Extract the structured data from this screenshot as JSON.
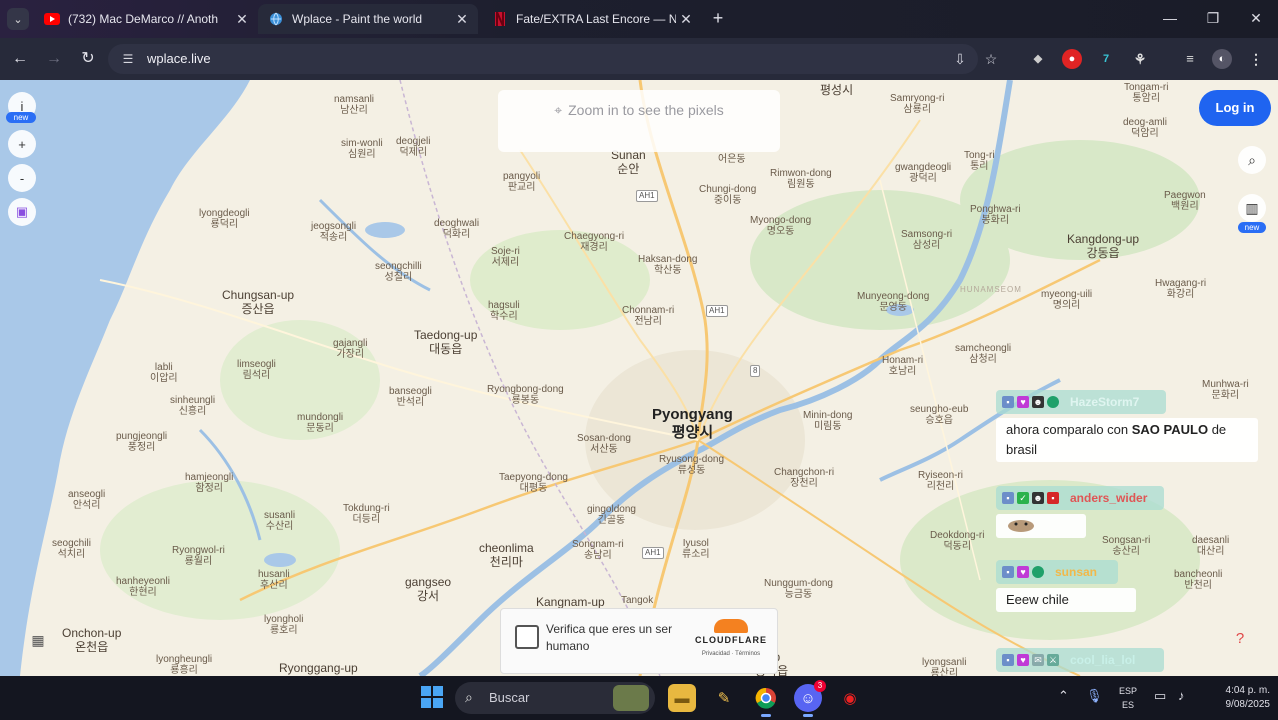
{
  "browser": {
    "tabs": [
      {
        "title": "(732) Mac DeMarco // Another",
        "favicon": "youtube-icon",
        "active": false
      },
      {
        "title": "Wplace - Paint the world",
        "favicon": "globe-icon",
        "active": true
      },
      {
        "title": "Fate/EXTRA Last Encore — Netf",
        "favicon": "netflix-icon",
        "active": false
      }
    ],
    "url": "wplace.live",
    "new_tab_glyph": "+"
  },
  "map": {
    "zoom_hint": "Zoom in to see the pixels",
    "login_label": "Log in",
    "badge_new": "new",
    "left_tool_info": "i",
    "left_tool_zoom_in": "+",
    "left_tool_zoom_out": "-",
    "places": [
      {
        "en": "namsanli",
        "ko": "남산리"
      },
      {
        "en": "sim-wonli",
        "ko": "심원리"
      },
      {
        "en": "deogjeli",
        "ko": "덕제리"
      },
      {
        "en": "pangyoli",
        "ko": "판교리"
      },
      {
        "en": "Sunan",
        "ko": "순안"
      },
      {
        "en": "",
        "ko": "어은동"
      },
      {
        "en": "",
        "ko": "평성시"
      },
      {
        "en": "Samryong-ri",
        "ko": "삼룡리"
      },
      {
        "en": "Tongam-ri",
        "ko": "통암리"
      },
      {
        "en": "deog-amli",
        "ko": "덕암리"
      },
      {
        "en": "lyongdeogli",
        "ko": "룡덕리"
      },
      {
        "en": "jeogsongli",
        "ko": "적송리"
      },
      {
        "en": "deoghwali",
        "ko": "덕화리"
      },
      {
        "en": "Soje-ri",
        "ko": "서제리"
      },
      {
        "en": "Chaegyong-ri",
        "ko": "재경리"
      },
      {
        "en": "Chungi-dong",
        "ko": "중이동"
      },
      {
        "en": "Rimwon-dong",
        "ko": "림원동"
      },
      {
        "en": "gwangdeogli",
        "ko": "광덕리"
      },
      {
        "en": "Tong-ri",
        "ko": "통리"
      },
      {
        "en": "Myongo-dong",
        "ko": "명오동"
      },
      {
        "en": "Haksan-dong",
        "ko": "학산동"
      },
      {
        "en": "Samsong-ri",
        "ko": "삼성리"
      },
      {
        "en": "Ponghwa-ri",
        "ko": "봉화리"
      },
      {
        "en": "Paegwon",
        "ko": "백원리"
      },
      {
        "en": "Kangdong-up",
        "ko": "강동읍"
      },
      {
        "en": "seongchilli",
        "ko": "성칠리"
      },
      {
        "en": "Chungsan-up",
        "ko": "증산읍"
      },
      {
        "en": "hagsuli",
        "ko": "학수리"
      },
      {
        "en": "Chonnam-ri",
        "ko": "전남리"
      },
      {
        "en": "Munyeong-dong",
        "ko": "문영동"
      },
      {
        "en": "myeong-uili",
        "ko": "명의리"
      },
      {
        "en": "Hwagang-ri",
        "ko": "화강리"
      },
      {
        "en": "Taedong-up",
        "ko": "대동읍"
      },
      {
        "en": "gajangli",
        "ko": "가장리"
      },
      {
        "en": "samcheongli",
        "ko": "삼청리"
      },
      {
        "en": "Honam-ri",
        "ko": "호남리"
      },
      {
        "en": "labli",
        "ko": "이압리"
      },
      {
        "en": "limseogli",
        "ko": "림석리"
      },
      {
        "en": "banseogli",
        "ko": "반석리"
      },
      {
        "en": "Ryongbong-dong",
        "ko": "룡봉동"
      },
      {
        "en": "sinheungli",
        "ko": "신흥리"
      },
      {
        "en": "mundongli",
        "ko": "문동리"
      },
      {
        "en": "Pyongyang",
        "ko": "평양시"
      },
      {
        "en": "Minin-dong",
        "ko": "미림동"
      },
      {
        "en": "seungho-eub",
        "ko": "승호읍"
      },
      {
        "en": "Munhwa-ri",
        "ko": "문화리"
      },
      {
        "en": "pungjeongli",
        "ko": "풍정리"
      },
      {
        "en": "Sosan-dong",
        "ko": "서산동"
      },
      {
        "en": "Ryusong-dong",
        "ko": "류성동"
      },
      {
        "en": "Changchon-ri",
        "ko": "장천리"
      },
      {
        "en": "Ryiseon-ri",
        "ko": "리천리"
      },
      {
        "en": "anseogli",
        "ko": "안석리"
      },
      {
        "en": "hamjeongli",
        "ko": "함정리"
      },
      {
        "en": "Taepyong-dong",
        "ko": "대평동"
      },
      {
        "en": "seogchili",
        "ko": "석치리"
      },
      {
        "en": "susanli",
        "ko": "수산리"
      },
      {
        "en": "Tokdung-ri",
        "ko": "더등리"
      },
      {
        "en": "gingoldong",
        "ko": "긴골동"
      },
      {
        "en": "Songnam-ri",
        "ko": "송남리"
      },
      {
        "en": "Iyusol",
        "ko": "류소리"
      },
      {
        "en": "Deokdong-ri",
        "ko": "덕동리"
      },
      {
        "en": "Songsan-ri",
        "ko": "송산리"
      },
      {
        "en": "daesanli",
        "ko": "대산리"
      },
      {
        "en": "Ryongwol-ri",
        "ko": "룡월리"
      },
      {
        "en": "cheonlima",
        "ko": "천리마"
      },
      {
        "en": "hanheyeonli",
        "ko": "한현리"
      },
      {
        "en": "husanli",
        "ko": "후산리"
      },
      {
        "en": "gangseo",
        "ko": "강서"
      },
      {
        "en": "Nunggum-dong",
        "ko": "능금동"
      },
      {
        "en": "bancheonli",
        "ko": "반천리"
      },
      {
        "en": "Onchon-up",
        "ko": "온천읍"
      },
      {
        "en": "lyongholi",
        "ko": "룡호리"
      },
      {
        "en": "lyongheungli",
        "ko": "룡흥리"
      },
      {
        "en": "Ryonggang-up",
        "ko": ""
      },
      {
        "en": "Kangnam-up",
        "ko": ""
      },
      {
        "en": "Tangok",
        "ko": ""
      },
      {
        "en": "-up",
        "ko": "중화읍"
      },
      {
        "en": "lyongsanli",
        "ko": "룡산리"
      }
    ],
    "road_shields": [
      "AH1",
      "AH1",
      "8",
      "AH1"
    ],
    "map_watermark": "HUNAMSEOM",
    "colors": {
      "water": "#a9c8e8",
      "land": "#f4f0e4",
      "green": "#d8e8c8",
      "road": "#f7c873",
      "accent": "#1f64f0"
    }
  },
  "captcha": {
    "label": "Verifica que eres un ser humano",
    "brand": "CLOUDFLARE",
    "links": "Privacidad · Términos"
  },
  "chat": {
    "messages": [
      {
        "user": "HazeStorm7",
        "user_color": "#d2f0ea",
        "text_parts": [
          "ahora comparalo con ",
          "SAO PAULO",
          " de brasil"
        ]
      },
      {
        "user": "anders_wider",
        "user_color": "#e05555",
        "text_parts": []
      },
      {
        "user": "sunsan",
        "user_color": "#f1b84a",
        "text_parts": [
          "Eeew chile"
        ]
      },
      {
        "user": "cool_lia_lol",
        "user_color": "#c8f0e8",
        "text_parts": []
      }
    ]
  },
  "taskbar": {
    "search_placeholder": "Buscar",
    "lang_top": "ESP",
    "lang_bottom": "ES",
    "time": "4:04 p. m.",
    "date": "9/08/2025",
    "discord_badge": "3"
  }
}
